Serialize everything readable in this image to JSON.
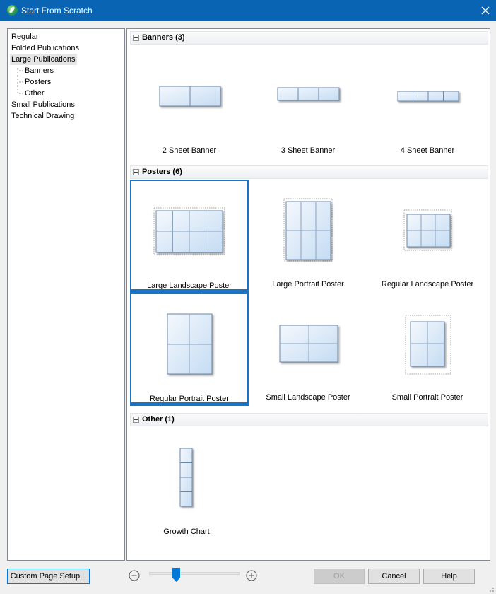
{
  "window": {
    "title": "Start From Scratch",
    "close_icon": "close-icon",
    "app_icon": "app-logo-icon"
  },
  "tree": {
    "items": [
      {
        "label": "Regular",
        "level": 0
      },
      {
        "label": "Folded Publications",
        "level": 0
      },
      {
        "label": "Large Publications",
        "level": 0,
        "selected": true
      },
      {
        "label": "Banners",
        "level": 1
      },
      {
        "label": "Posters",
        "level": 1
      },
      {
        "label": "Other",
        "level": 1
      },
      {
        "label": "Small Publications",
        "level": 0
      },
      {
        "label": "Technical Drawing",
        "level": 0
      }
    ]
  },
  "groups": [
    {
      "title": "Banners (3)",
      "items": [
        {
          "label": "2 Sheet Banner"
        },
        {
          "label": "3 Sheet Banner"
        },
        {
          "label": "4 Sheet Banner"
        }
      ]
    },
    {
      "title": "Posters (6)",
      "items": [
        {
          "label": "Large Landscape Poster",
          "selected": true
        },
        {
          "label": "Large Portrait Poster"
        },
        {
          "label": "Regular Landscape Poster"
        },
        {
          "label": "Regular Portrait Poster",
          "selected": true
        },
        {
          "label": "Small Landscape Poster"
        },
        {
          "label": "Small Portrait Poster"
        }
      ]
    },
    {
      "title": "Other (1)",
      "items": [
        {
          "label": "Growth Chart"
        }
      ]
    }
  ],
  "footer": {
    "custom_page_setup": "Custom Page Setup...",
    "ok": "OK",
    "cancel": "Cancel",
    "help": "Help",
    "zoom_level": 0.3
  },
  "colors": {
    "titlebar": "#0a64b4",
    "accent": "#1874c6"
  }
}
